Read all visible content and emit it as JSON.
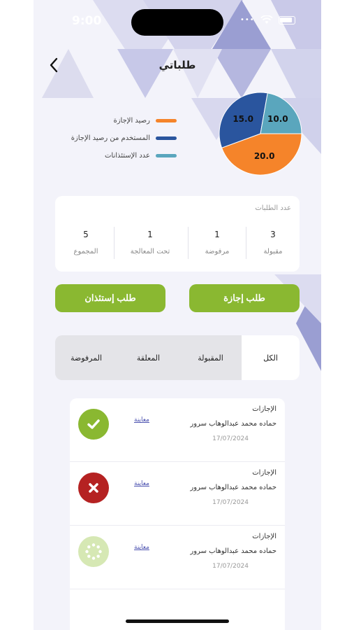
{
  "status_bar": {
    "time": "9:00",
    "dots": "•••"
  },
  "header": {
    "title": "طلباتي"
  },
  "legend": {
    "items": [
      {
        "label": "رصيد الإجازة",
        "color": "#f5842a"
      },
      {
        "label": "المستخدم من رصيد الإجازة",
        "color": "#2a559e"
      },
      {
        "label": "عدد الإستئذانات",
        "color": "#5aa6bd"
      }
    ]
  },
  "chart_data": {
    "type": "pie",
    "slices": [
      {
        "label": "20.0",
        "value": 20.0,
        "color": "#f5842a"
      },
      {
        "label": "15.0",
        "value": 15.0,
        "color": "#2a559e"
      },
      {
        "label": "10.0",
        "value": 10.0,
        "color": "#5aa6bd"
      }
    ]
  },
  "stats": {
    "title": "عدد الطلبات",
    "items": [
      {
        "value": "3",
        "label": "مقبولة"
      },
      {
        "value": "1",
        "label": "مرفوضة"
      },
      {
        "value": "1",
        "label": "تحت المعالجة"
      },
      {
        "value": "5",
        "label": "المجموع"
      }
    ]
  },
  "actions": {
    "leave_request": "طلب إجازة",
    "permission_request": "طلب إستئذان"
  },
  "tabs": [
    {
      "label": "الكل",
      "active": true
    },
    {
      "label": "المقبولة",
      "active": false
    },
    {
      "label": "المعلقة",
      "active": false
    },
    {
      "label": "المرفوضة",
      "active": false
    }
  ],
  "requests": [
    {
      "type": "الإجازات",
      "name": "حماده محمد عبدالوهاب سرور",
      "date": "17/07/2024",
      "link": "معاينة",
      "status": "approved",
      "icon": "check-icon"
    },
    {
      "type": "الإجازات",
      "name": "حماده محمد عبدالوهاب سرور",
      "date": "17/07/2024",
      "link": "معاينة",
      "status": "rejected",
      "icon": "x-icon"
    },
    {
      "type": "الإجازات",
      "name": "حماده محمد عبدالوهاب سرور",
      "date": "17/07/2024",
      "link": "معاينة",
      "status": "pending",
      "icon": "loading-icon"
    }
  ],
  "colors": {
    "accent_green": "#8ab831",
    "rejected_red": "#b52222",
    "pending_light_green": "#d6e8b4",
    "link_blue": "#4c52b0",
    "decor_purple": "#9b9fd4"
  }
}
